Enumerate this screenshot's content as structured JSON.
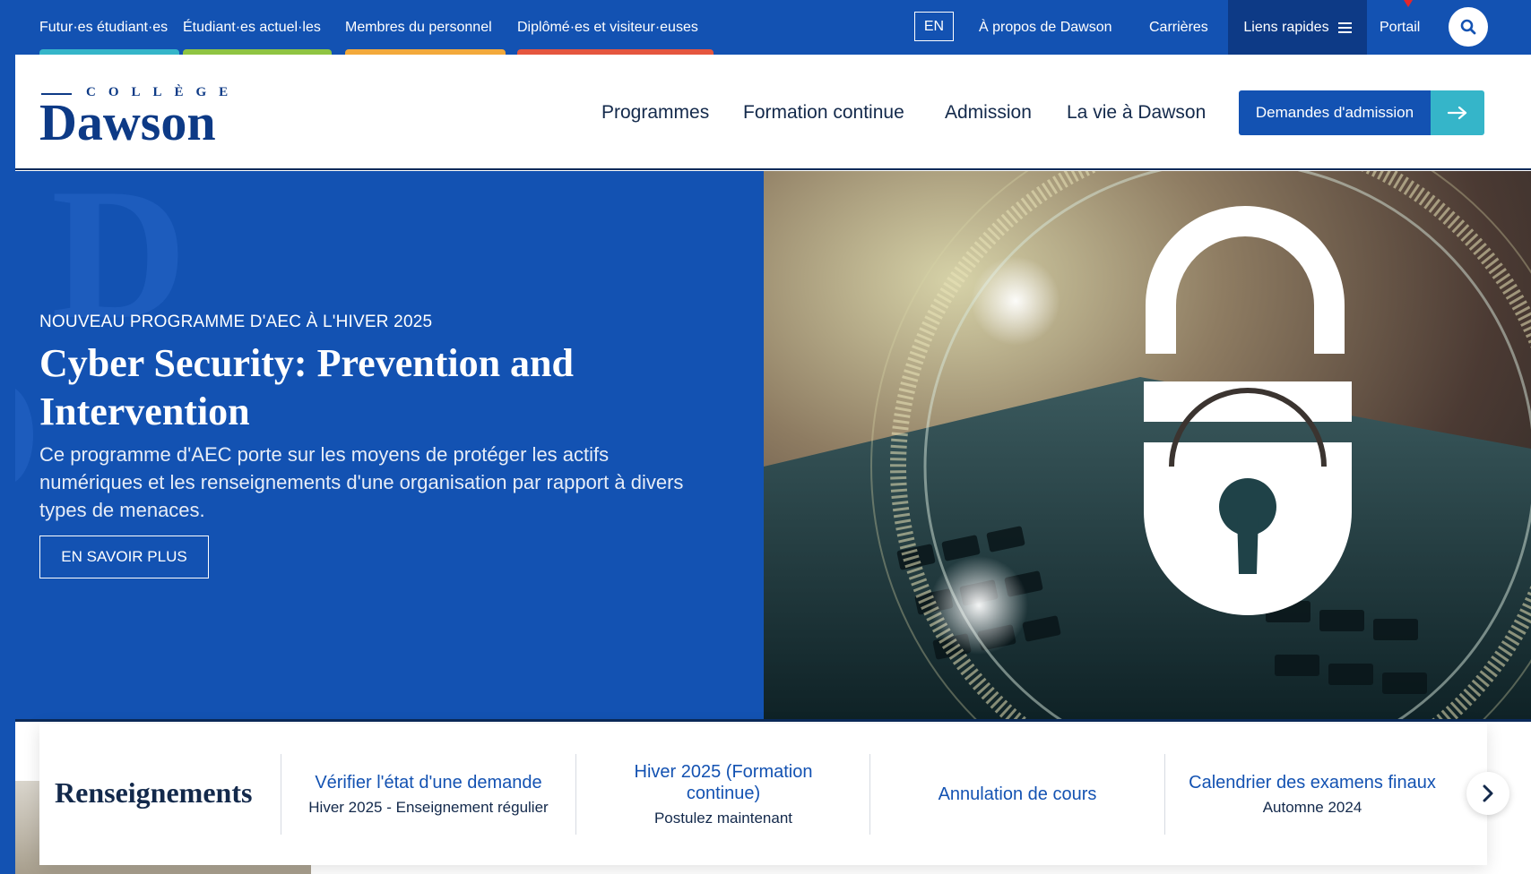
{
  "audience_nav": [
    {
      "label": "Futur·es étudiant·es",
      "color": "#35b5c9"
    },
    {
      "label": "Étudiant·es actuel·les",
      "color": "#8fc442"
    },
    {
      "label": "Membres du personnel",
      "color": "#f3a93b"
    },
    {
      "label": "Diplômé·es et visiteur·euses",
      "color": "#e5563f"
    }
  ],
  "utility_nav": {
    "language": "EN",
    "about": "À propos de Dawson",
    "careers": "Carrières",
    "quick_links": "Liens rapides",
    "portal": "Portail",
    "search_icon": "search-icon"
  },
  "logo": {
    "college": "COLLÈGE",
    "name": "Dawson"
  },
  "main_nav": [
    "Programmes",
    "Formation continue",
    "Admission",
    "La vie à Dawson"
  ],
  "apply_button": "Demandes d'admission",
  "hero": {
    "eyebrow": "NOUVEAU PROGRAMME D'AEC À L'HIVER 2025",
    "title": "Cyber Security: Prevention and Intervention",
    "description": "Ce programme d'AEC porte sur les moyens de protéger les actifs numériques et les renseignements d'une organisation par rapport à divers types de menaces.",
    "cta": "EN SAVOIR PLUS",
    "image": "padlock-over-laptop-keyboard"
  },
  "info_strip": {
    "title": "Renseignements",
    "items": [
      {
        "link": "Vérifier l'état d'une demande",
        "sub": "Hiver 2025 - Enseignement régulier"
      },
      {
        "link": "Hiver 2025 (Formation continue)",
        "sub": "Postulez maintenant"
      },
      {
        "link": "Annulation de cours",
        "sub": ""
      },
      {
        "link": "Calendrier des examens finaux",
        "sub": "Automne 2024"
      }
    ]
  },
  "colors": {
    "primary_blue": "#1352b2",
    "dark_blue": "#0d3a86",
    "teal": "#35b5c9",
    "navy_text": "#13294b"
  }
}
